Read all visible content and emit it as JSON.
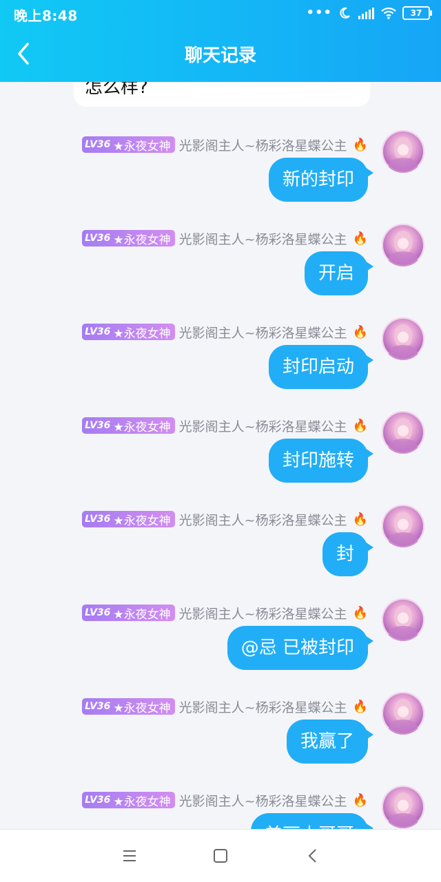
{
  "status": {
    "time": "晚上8:48",
    "dots": "•••",
    "battery": "37"
  },
  "header": {
    "title": "聊天记录"
  },
  "previous_message": {
    "text": "怎么样?"
  },
  "messages": [
    {
      "level": "LV36",
      "title": "★永夜女神",
      "nickname": "光影阁主人~杨彩洛星蝶公主",
      "text": "新的封印"
    },
    {
      "level": "LV36",
      "title": "★永夜女神",
      "nickname": "光影阁主人~杨彩洛星蝶公主",
      "text": "开启"
    },
    {
      "level": "LV36",
      "title": "★永夜女神",
      "nickname": "光影阁主人~杨彩洛星蝶公主",
      "text": "封印启动"
    },
    {
      "level": "LV36",
      "title": "★永夜女神",
      "nickname": "光影阁主人~杨彩洛星蝶公主",
      "text": "封印施转"
    },
    {
      "level": "LV36",
      "title": "★永夜女神",
      "nickname": "光影阁主人~杨彩洛星蝶公主",
      "text": "封"
    },
    {
      "level": "LV36",
      "title": "★永夜女神",
      "nickname": "光影阁主人~杨彩洛星蝶公主",
      "text": "@忌 已被封印"
    },
    {
      "level": "LV36",
      "title": "★永夜女神",
      "nickname": "光影阁主人~杨彩洛星蝶公主",
      "text": "我赢了"
    },
    {
      "level": "LV36",
      "title": "★永夜女神",
      "nickname": "光影阁主人~杨彩洛星蝶公主",
      "text": "美丽大哥哥"
    }
  ],
  "colors": {
    "header_start": "#11c9f5",
    "header_end": "#16a6f6",
    "bubble": "#21aef6",
    "badge": "#b784f1"
  }
}
